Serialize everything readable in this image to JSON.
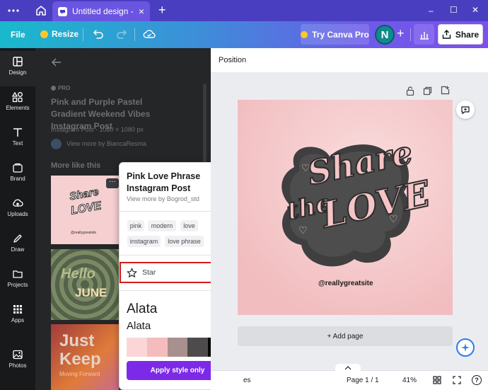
{
  "titlebar": {
    "menu_icon": "more-horizontal-icon",
    "home_icon": "home-icon",
    "tab_title": "Untitled design - In...",
    "tab_close": "×",
    "new_tab": "+",
    "window_controls": [
      "–",
      "☐",
      "✕"
    ]
  },
  "toolbar": {
    "file_label": "File",
    "resize_label": "Resize",
    "try_pro_label": "Try Canva Pro",
    "avatar_initial": "N",
    "add_label": "+",
    "share_label": "Share"
  },
  "sidebar": {
    "items": [
      {
        "label": "Design",
        "icon": "design-icon"
      },
      {
        "label": "Elements",
        "icon": "elements-icon"
      },
      {
        "label": "Text",
        "icon": "text-icon"
      },
      {
        "label": "Brand",
        "icon": "brand-icon"
      },
      {
        "label": "Uploads",
        "icon": "uploads-icon"
      },
      {
        "label": "Draw",
        "icon": "draw-icon"
      },
      {
        "label": "Projects",
        "icon": "projects-icon"
      },
      {
        "label": "Apps",
        "icon": "apps-icon"
      },
      {
        "label": "Photos",
        "icon": "photos-icon"
      }
    ]
  },
  "panel": {
    "pro_badge": "PRO",
    "template_title": "Pink and Purple Pastel Gradient Weekend Vibes Instagram Post",
    "template_meta": "Instagram Post · 1080 × 1080 px",
    "author_link": "View more by BiancaResma",
    "more_like_this": "More like this",
    "thumb_handle": "@reallygreatsite",
    "thumb_hello": "Hello",
    "thumb_june": "JUNE",
    "thumb_just": "Just",
    "thumb_keep": "Keep",
    "thumb_sub": "Moving Forward"
  },
  "popup": {
    "title": "Pink Love Phrase Instagram Post",
    "author": "View more by Bogrod_std",
    "tags": [
      "pink",
      "modern",
      "love",
      "instagram",
      "love phrase"
    ],
    "star_label": "Star",
    "font_heading": "Alata",
    "font_sub": "Alata",
    "palette": [
      "#fbd6d6",
      "#f4bcbd",
      "#a8908e",
      "#4d4b4b",
      "#050505"
    ],
    "apply_label": "Apply style only"
  },
  "canvas": {
    "position_label": "Position",
    "design_text_1": "Share",
    "design_text_2": "the",
    "design_text_3": "LOVE",
    "design_handle": "@reallygreatsite",
    "add_page_label": "+ Add page"
  },
  "bottombar": {
    "notes_partial": "es",
    "page_indicator": "Page 1 / 1",
    "zoom": "41%"
  }
}
